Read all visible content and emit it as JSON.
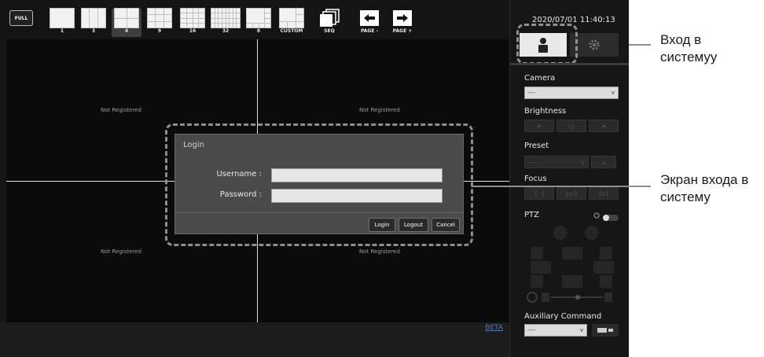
{
  "toolbar": {
    "full_label": "FULL",
    "layouts": [
      {
        "label": "1"
      },
      {
        "label": "3"
      },
      {
        "label": "4"
      },
      {
        "label": "9"
      },
      {
        "label": "16"
      },
      {
        "label": "32"
      },
      {
        "label": "8"
      },
      {
        "label": "CUSTOM"
      },
      {
        "label": "SEQ"
      },
      {
        "label": "PAGE -"
      },
      {
        "label": "PAGE +"
      }
    ]
  },
  "video": {
    "cells": [
      {
        "status": "Not Registered"
      },
      {
        "status": "Not Registered"
      },
      {
        "status": "Not Registered"
      },
      {
        "status": "Not Registered"
      }
    ],
    "beta_link": "BETA"
  },
  "login_dialog": {
    "title": "Login",
    "username_label": "Username :",
    "password_label": "Password :",
    "username_value": "",
    "password_value": "",
    "login_button": "Login",
    "logout_button": "Logout",
    "cancel_button": "Cancel"
  },
  "sidebar": {
    "datetime": "2020/07/01 11:40:13",
    "camera_label": "Camera",
    "camera_value": "----",
    "brightness_label": "Brightness",
    "preset_label": "Preset",
    "preset_value": "----",
    "focus_label": "Focus",
    "ptz_label": "PTZ",
    "aux_label": "Auxiliary Command",
    "aux_value": "----",
    "select_arrow": "v"
  },
  "callouts": {
    "login": "Вход в системуу",
    "login_screen": "Экран входа в систему"
  }
}
